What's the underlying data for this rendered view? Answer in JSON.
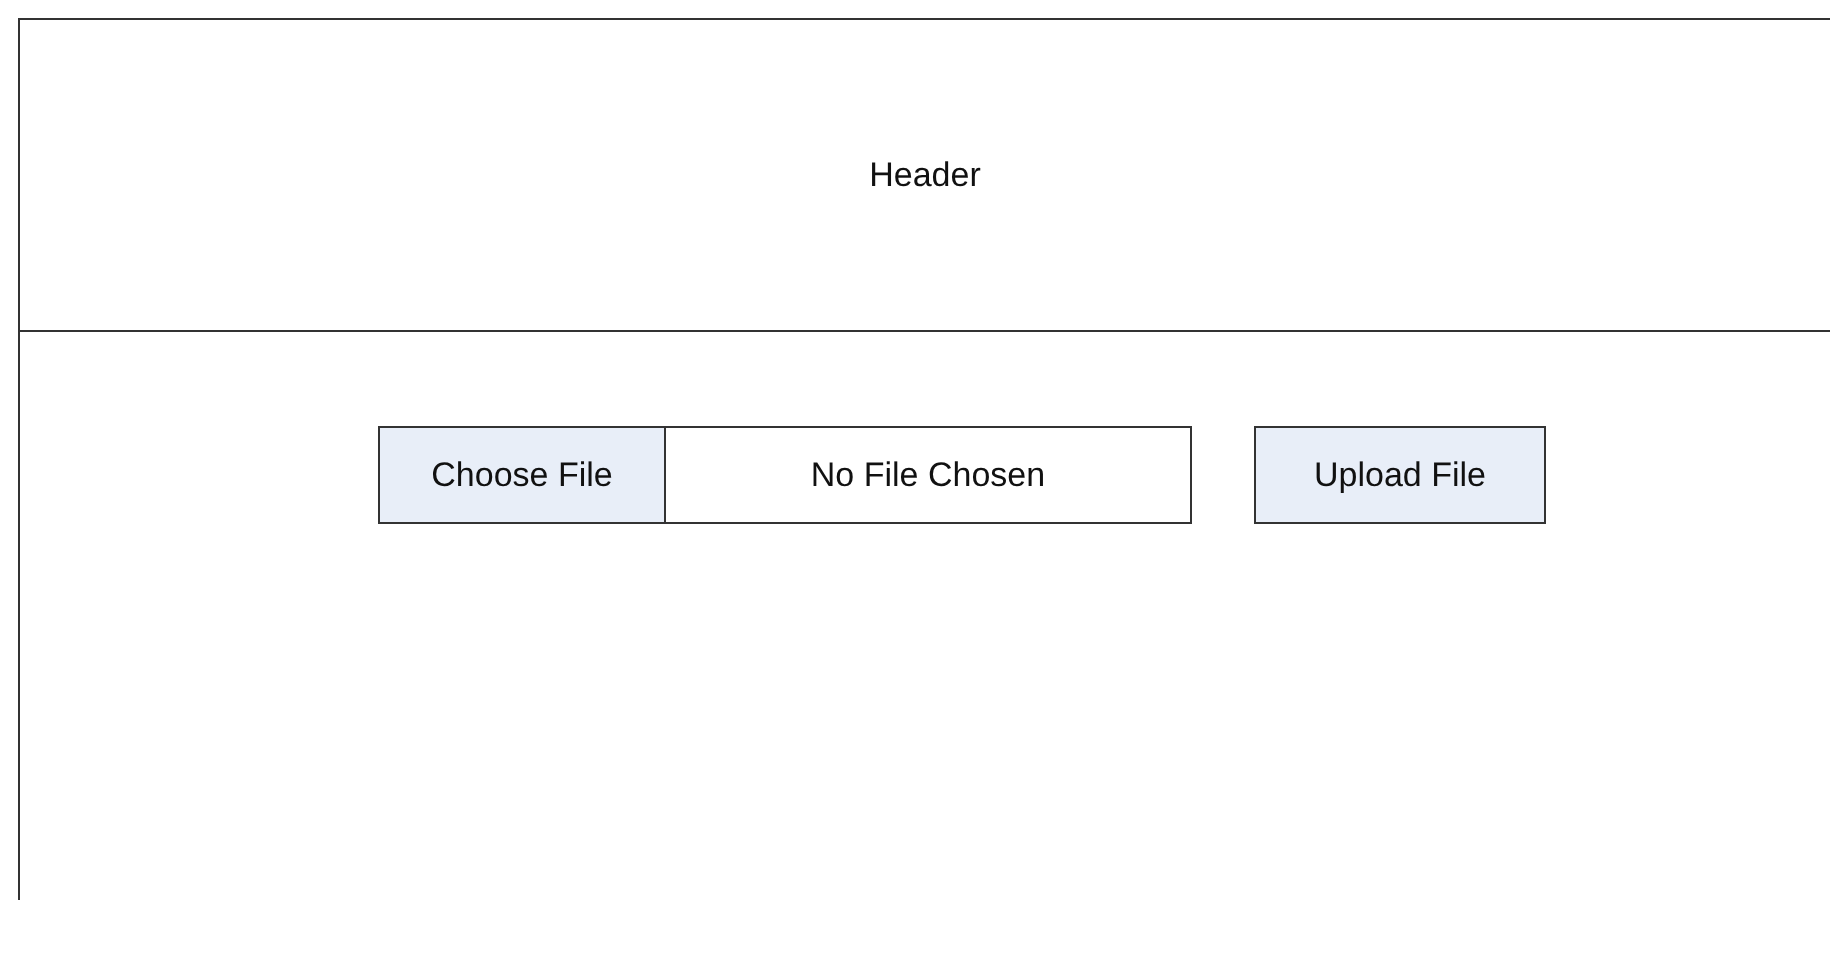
{
  "header": {
    "title": "Header"
  },
  "file_input": {
    "button": "Choose File",
    "status": "No File Chosen"
  },
  "upload_button": "Upload File"
}
